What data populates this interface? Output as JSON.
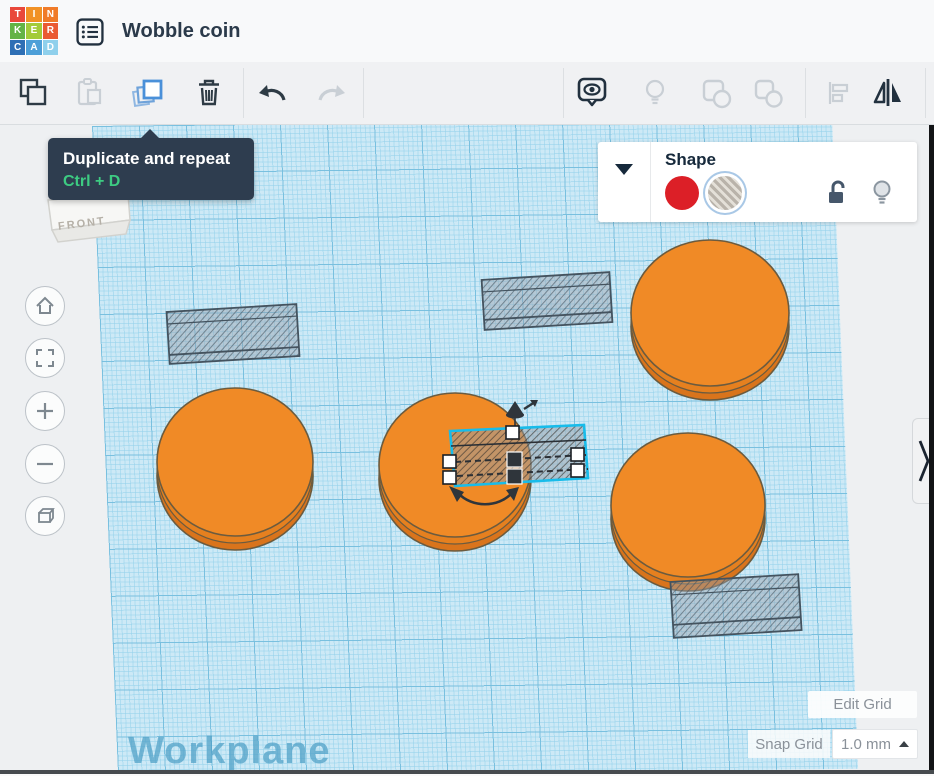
{
  "app": {
    "name": "Tinkercad",
    "title": "Wobble coin"
  },
  "header": {
    "logo_letters": [
      "T",
      "I",
      "N",
      "K",
      "E",
      "R",
      "C",
      "A",
      "D"
    ]
  },
  "toolbar": {
    "buttons": [
      "copy",
      "paste",
      "duplicate",
      "delete",
      "undo",
      "redo",
      "show-all",
      "toggle-visibility",
      "group",
      "ungroup",
      "align",
      "mirror"
    ],
    "tooltip": {
      "title": "Duplicate and repeat",
      "shortcut": "Ctrl + D"
    }
  },
  "shape_panel": {
    "title": "Shape",
    "swatches": [
      "solid",
      "hole"
    ],
    "selected_swatch": "hole"
  },
  "viewcube": {
    "label": "FRONT"
  },
  "workplane": {
    "label": "Workplane"
  },
  "grid_controls": {
    "edit_grid": "Edit Grid",
    "snap_grid": "Snap Grid",
    "snap_value": "1.0 mm"
  },
  "scene": {
    "coins": 4,
    "hole_boxes": 4,
    "selected_object": "hole-box"
  },
  "colors": {
    "solid_swatch": "#DC1F27",
    "selection_outline": "#18BCEA",
    "coin_top": "#F08A26",
    "coin_side": "#D9741C",
    "workplane": "#CDE9F6",
    "tooltip_bg": "#2E3D4F",
    "tooltip_shortcut": "#3DCB82",
    "duplicate_icon": "#5B9AD6"
  }
}
